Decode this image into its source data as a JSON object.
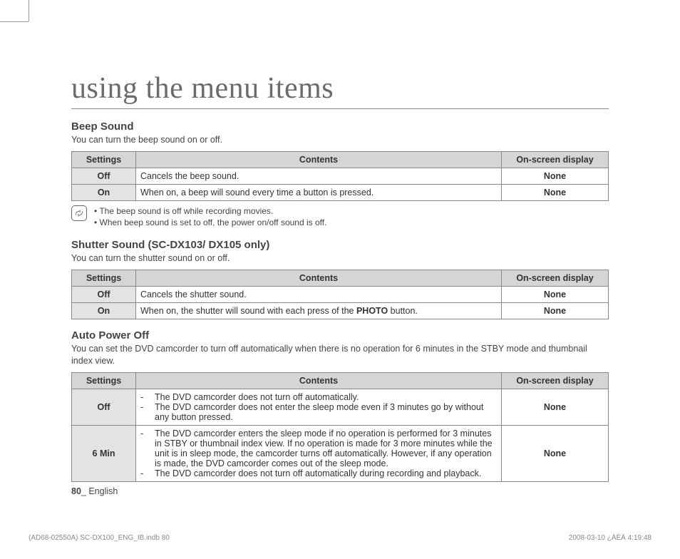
{
  "title": "using the menu items",
  "sections": {
    "beep": {
      "heading": "Beep Sound",
      "sub": "You can turn the beep sound on or off.",
      "headers": {
        "settings": "Settings",
        "contents": "Contents",
        "osd": "On-screen display"
      },
      "rows": {
        "off": {
          "setting": "Off",
          "content": "Cancels the beep sound.",
          "osd": "None"
        },
        "on": {
          "setting": "On",
          "content": "When on, a beep will sound every time a button is pressed.",
          "osd": "None"
        }
      },
      "notes": {
        "n1": "The beep sound is off while recording movies.",
        "n2": "When beep sound is set to off, the power on/off sound is off."
      }
    },
    "shutter": {
      "heading": "Shutter Sound (SC-DX103/ DX105 only)",
      "sub": "You can turn the shutter sound on or off.",
      "headers": {
        "settings": "Settings",
        "contents": "Contents",
        "osd": "On-screen display"
      },
      "rows": {
        "off": {
          "setting": "Off",
          "content_pre": "Cancels the shutter sound.",
          "osd": "None"
        },
        "on": {
          "setting": "On",
          "content_pre": "When on, the shutter will sound with each press of the ",
          "bold": "PHOTO",
          "content_post": " button.",
          "osd": "None"
        }
      }
    },
    "autopower": {
      "heading": "Auto Power Off",
      "sub": "You can set the DVD camcorder to turn off automatically when there is no operation for 6 minutes in the STBY mode and thumbnail index view.",
      "headers": {
        "settings": "Settings",
        "contents": "Contents",
        "osd": "On-screen display"
      },
      "rows": {
        "off": {
          "setting": "Off",
          "items": {
            "i1": "The DVD camcorder does not turn off automatically.",
            "i2": "The DVD camcorder does not enter the sleep mode even if 3 minutes go by without any button pressed."
          },
          "osd": "None"
        },
        "six": {
          "setting": "6 Min",
          "items": {
            "i1": "The DVD camcorder enters the sleep mode if no operation is performed for 3 minutes in STBY or thumbnail index view. If no operation is made for 3 more minutes while the unit is in sleep mode, the camcorder turns off automatically. However, if any operation is made, the DVD camcorder comes out of the sleep mode.",
            "i2": "The DVD camcorder does not turn off automatically during recording and playback."
          },
          "osd": "None"
        }
      }
    }
  },
  "footer": {
    "pagenum": "80",
    "sep": "_ ",
    "lang": "English"
  },
  "printinfo": {
    "left": "(AD68-02550A) SC-DX100_ENG_IB.indb   80",
    "right": "2008-03-10   ¿ÀÈÄ 4:19:48"
  }
}
